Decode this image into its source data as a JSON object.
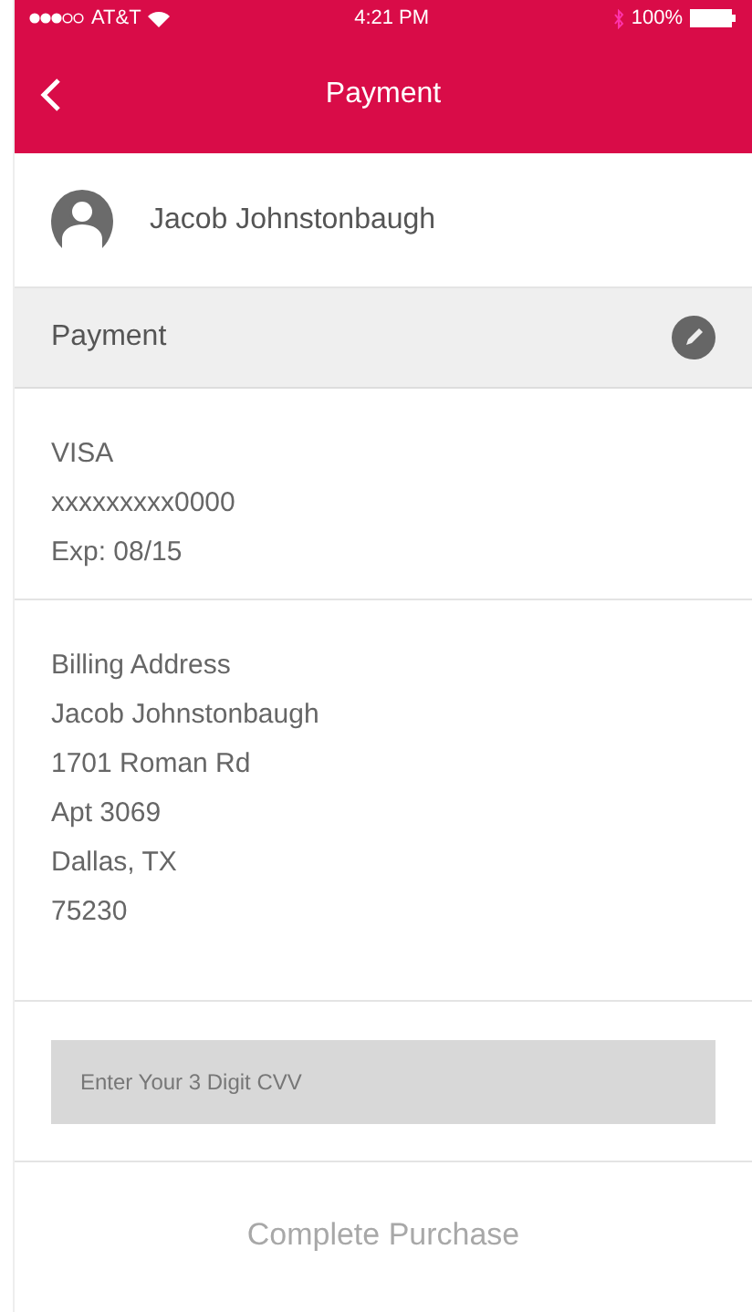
{
  "status_bar": {
    "carrier": "AT&T",
    "time": "4:21 PM",
    "battery": "100%"
  },
  "nav": {
    "title": "Payment"
  },
  "user": {
    "name": "Jacob Johnstonbaugh"
  },
  "payment_header": {
    "title": "Payment"
  },
  "card": {
    "lines": [
      "VISA",
      "xxxxxxxxx0000",
      "Exp: 08/15"
    ]
  },
  "billing": {
    "lines": [
      "Billing Address",
      "Jacob Johnstonbaugh",
      "1701 Roman Rd",
      "Apt 3069",
      "Dallas, TX",
      "75230"
    ]
  },
  "cvv_field": {
    "placeholder": "Enter Your 3 Digit CVV"
  },
  "complete_button": {
    "label": "Complete Purchase",
    "disabled": true
  }
}
